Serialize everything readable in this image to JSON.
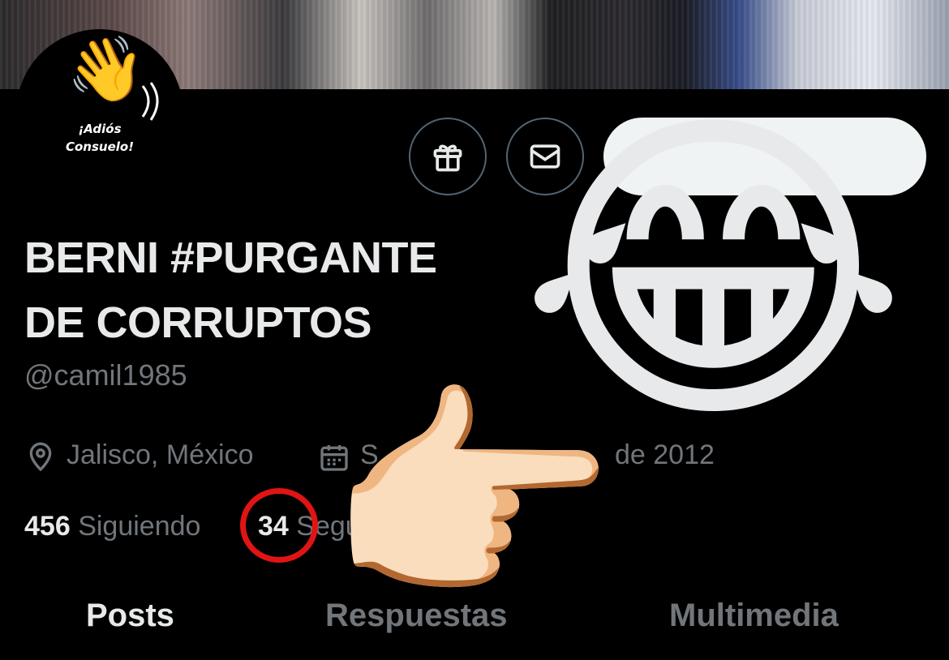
{
  "profile": {
    "avatar_text_line1": "¡Adiós",
    "avatar_text_line2": "Consuelo!",
    "name_line1": "BERNI #PURGANTE",
    "name_line2": "DE CORRUPTOS",
    "handle": "@camil1985",
    "location": "Jalisco, México",
    "joined_visible_start": "S",
    "joined_visible_end": "de 2012",
    "following_count": "456",
    "following_label": "Siguiendo",
    "followers_count": "34",
    "followers_label": "Seguidore"
  },
  "tabs": [
    {
      "label": "Posts",
      "active": true
    },
    {
      "label": "Respuestas",
      "active": false
    },
    {
      "label": "Multimedia",
      "active": false
    }
  ],
  "icons": {
    "gift": "gift-icon",
    "message": "envelope-icon",
    "location": "location-pin-icon",
    "calendar": "calendar-icon"
  },
  "overlays": {
    "laugh_emoji": "😂",
    "point_emoji": "👉🏻",
    "wave_emoji": "👋"
  },
  "colors": {
    "background": "#000000",
    "text_primary": "#e7e9ea",
    "text_secondary": "#71767b",
    "highlight_ring": "#e11414"
  }
}
